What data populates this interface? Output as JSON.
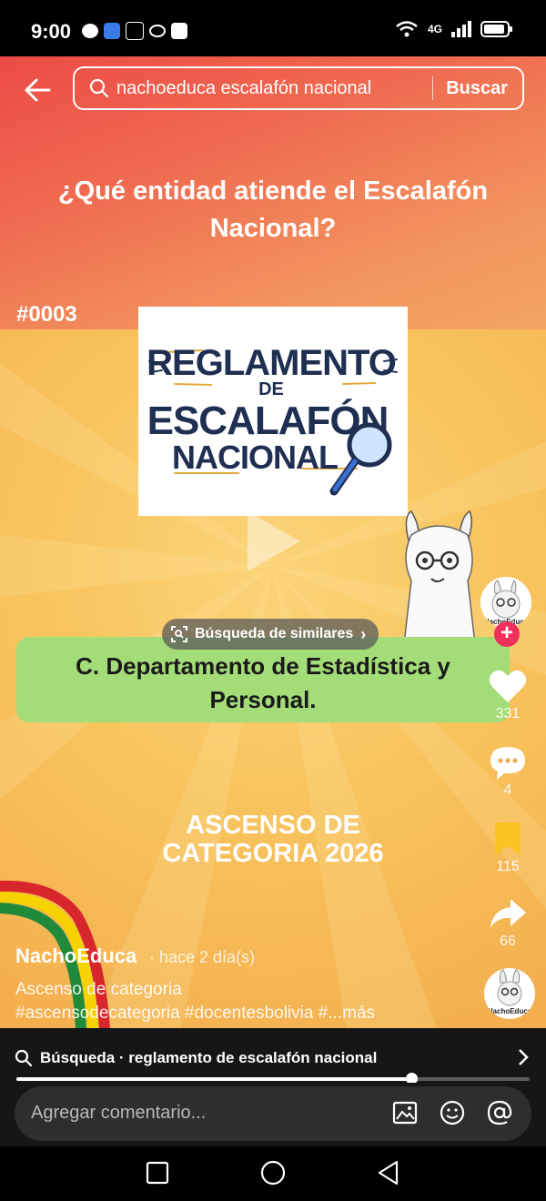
{
  "status": {
    "time": "9:00",
    "network": "4G"
  },
  "search": {
    "query": "nachoeduca escalafón nacional",
    "button": "Buscar"
  },
  "video": {
    "question": "¿Qué entidad atiende el Escalafón Nacional?",
    "number_tag": "#0003",
    "card": {
      "line1": "REGLAMENTO",
      "line2": "DE",
      "line3": "ESCALAFÓN",
      "line4": "NACIONAL"
    },
    "answer": "C. Departamento de Estadística y Personal.",
    "similar": "Búsqueda de similares",
    "ascenso_line1": "ASCENSO DE",
    "ascenso_line2": "CATEGORIA 2026"
  },
  "post": {
    "author": "NachoEduca",
    "posted": "· hace 2 día(s)",
    "caption": "Ascenso de categoria",
    "tags": "#ascensodecategoria #docentesbolivia #...más"
  },
  "rail": {
    "avatar_label": "NachoEduca",
    "likes": "331",
    "comments": "4",
    "saves": "115",
    "shares": "66"
  },
  "bottom_search": {
    "text": "Búsqueda · reglamento de escalafón nacional"
  },
  "progress": {
    "fraction": 0.77
  },
  "comment": {
    "placeholder": "Agregar comentario..."
  },
  "colors": {
    "answer_bg": "#a4dc78",
    "follow": "#f0315b",
    "save": "#f9c423"
  }
}
